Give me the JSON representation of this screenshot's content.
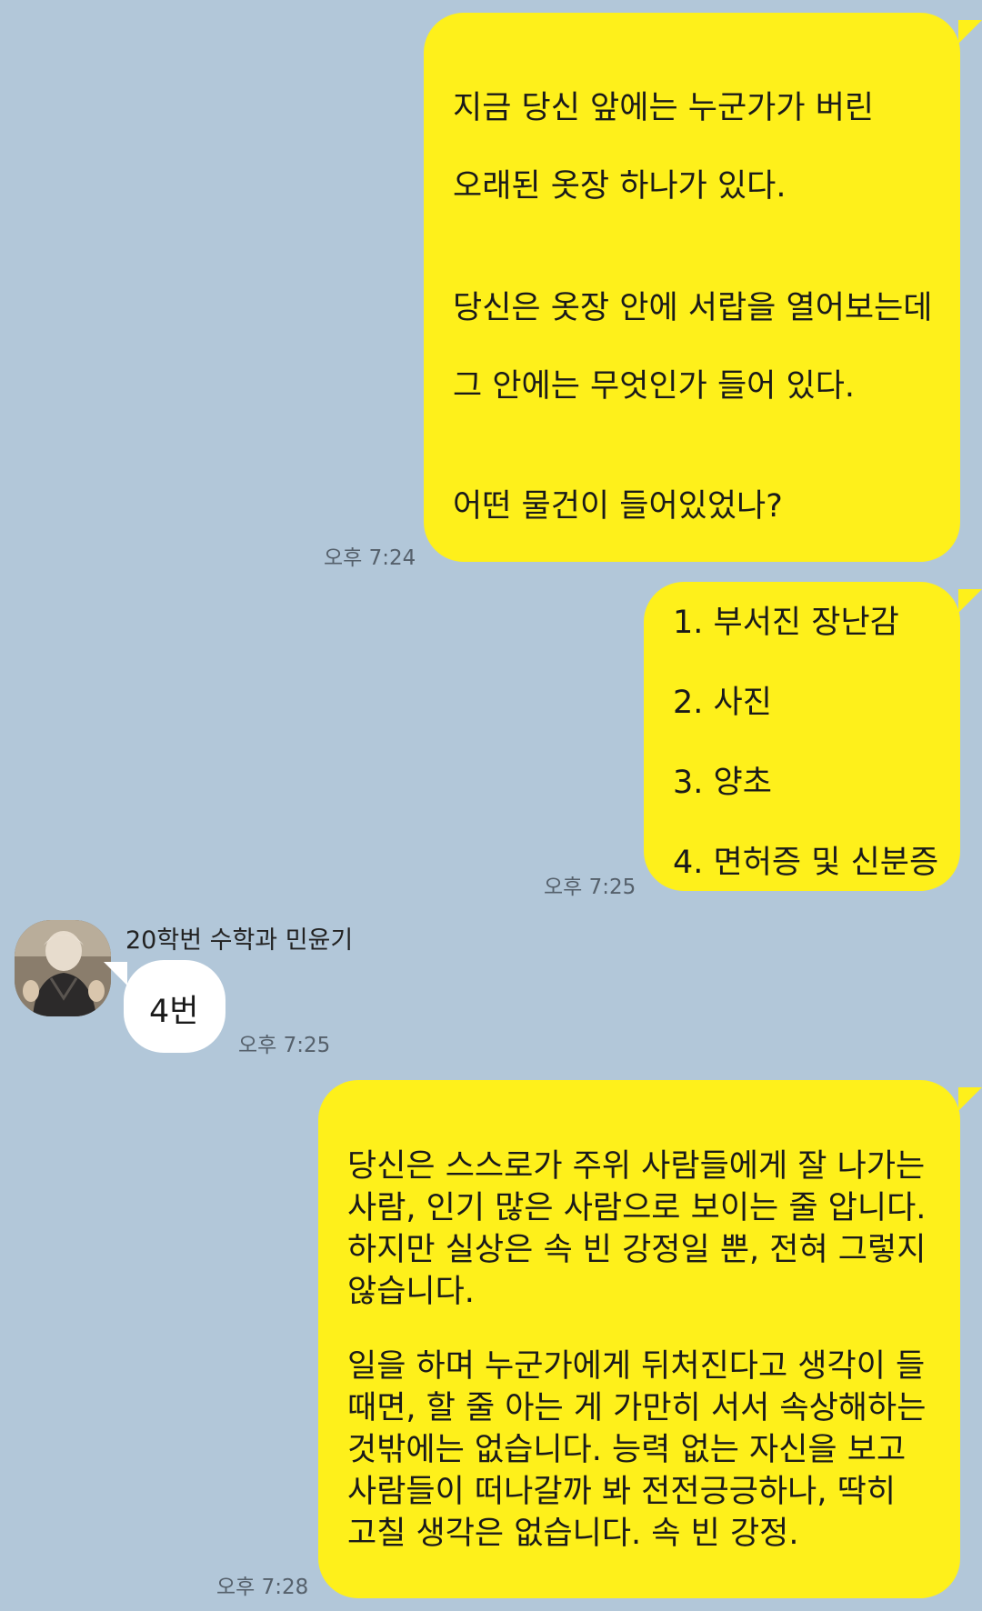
{
  "messages": [
    {
      "from": "me",
      "lines": [
        "지금 당신 앞에는 누군가가 버린",
        "오래된 옷장 하나가 있다.",
        "당신은 옷장 안에 서랍을 열어보는데",
        "그 안에는 무엇인가 들어 있다.",
        "어떤 물건이 들어있었나?"
      ],
      "time": "오후 7:24"
    },
    {
      "from": "me",
      "lines": [
        "1. 부서진 장난감",
        "2. 사진",
        "3. 양초",
        "4. 면허증 및 신분증"
      ],
      "time": "오후 7:25"
    },
    {
      "from": "other",
      "sender": "20학번 수학과 민윤기",
      "lines": [
        "4번"
      ],
      "time": "오후 7:25"
    },
    {
      "from": "me",
      "lines": [
        "당신은 스스로가 주위 사람들에게 잘 나가는",
        "사람, 인기 많은 사람으로 보이는 줄 압니다.",
        "하지만 실상은 속 빈 강정일 뿐, 전혀 그렇지",
        "않습니다.",
        "일을 하며 누군가에게 뒤처진다고 생각이 들",
        "때면, 할 줄 아는 게 가만히 서서 속상해하는",
        "것밖에는 없습니다. 능력 없는 자신을 보고",
        "사람들이 떠나갈까 봐 전전긍긍하나, 딱히",
        "고칠 생각은 없습니다. 속 빈 강정."
      ],
      "time": "오후 7:28"
    }
  ],
  "colors": {
    "background": "#b2c7d9",
    "my_bubble": "#fef01b",
    "other_bubble": "#ffffff"
  },
  "icons": {
    "avatar": "profile-photo"
  }
}
